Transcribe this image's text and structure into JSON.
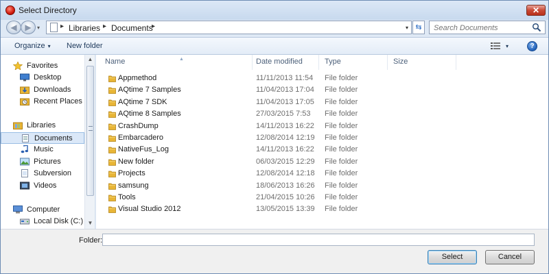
{
  "window": {
    "title": "Select Directory",
    "close_glyph": "✕"
  },
  "nav_buttons": {
    "back_glyph": "◀",
    "forward_glyph": "▶",
    "history_glyph": "▾"
  },
  "address": {
    "crumbs": [
      "Libraries",
      "Documents"
    ],
    "separator": "▸",
    "dropdown_glyph": "▾",
    "refresh_glyph": "⇆"
  },
  "search": {
    "placeholder": "Search Documents"
  },
  "toolbar": {
    "organize": "Organize",
    "organize_arrow": "▾",
    "new_folder": "New folder",
    "view_dd_glyph": "▾",
    "help": "?"
  },
  "navpane": {
    "groups": [
      {
        "label": "Favorites",
        "icon": "star-icon",
        "items": [
          {
            "label": "Desktop",
            "icon": "desktop-icon"
          },
          {
            "label": "Downloads",
            "icon": "downloads-icon"
          },
          {
            "label": "Recent Places",
            "icon": "recent-places-icon"
          }
        ]
      },
      {
        "label": "Libraries",
        "icon": "libraries-icon",
        "items": [
          {
            "label": "Documents",
            "icon": "documents-icon",
            "selected": true
          },
          {
            "label": "Music",
            "icon": "music-icon"
          },
          {
            "label": "Pictures",
            "icon": "pictures-icon"
          },
          {
            "label": "Subversion",
            "icon": "subversion-icon"
          },
          {
            "label": "Videos",
            "icon": "videos-icon"
          }
        ]
      },
      {
        "label": "Computer",
        "icon": "computer-icon",
        "items": [
          {
            "label": "Local Disk (C:)",
            "icon": "local-disk-icon"
          }
        ]
      }
    ]
  },
  "filelist": {
    "columns": [
      "Name",
      "Date modified",
      "Type",
      "Size"
    ],
    "rows": [
      {
        "name": "Appmethod",
        "date": "11/11/2013 11:54",
        "type": "File folder"
      },
      {
        "name": "AQtime 7 Samples",
        "date": "11/04/2013 17:04",
        "type": "File folder"
      },
      {
        "name": "AQtime 7 SDK",
        "date": "11/04/2013 17:05",
        "type": "File folder"
      },
      {
        "name": "AQtime 8 Samples",
        "date": "27/03/2015 7:53",
        "type": "File folder"
      },
      {
        "name": "CrashDump",
        "date": "14/11/2013 16:22",
        "type": "File folder"
      },
      {
        "name": "Embarcadero",
        "date": "12/08/2014 12:19",
        "type": "File folder"
      },
      {
        "name": "NativeFus_Log",
        "date": "14/11/2013 16:22",
        "type": "File folder"
      },
      {
        "name": "New folder",
        "date": "06/03/2015 12:29",
        "type": "File folder"
      },
      {
        "name": "Projects",
        "date": "12/08/2014 12:18",
        "type": "File folder"
      },
      {
        "name": "samsung",
        "date": "18/06/2013 16:26",
        "type": "File folder"
      },
      {
        "name": "Tools",
        "date": "21/04/2015 10:26",
        "type": "File folder"
      },
      {
        "name": "Visual Studio 2012",
        "date": "13/05/2015 13:39",
        "type": "File folder"
      }
    ]
  },
  "bottom": {
    "folder_label": "Folder:",
    "folder_value": "",
    "select": "Select",
    "cancel": "Cancel"
  },
  "colors": {
    "folder": "#e8b536",
    "selection": "#dbe8f8",
    "accent": "#1e395b"
  }
}
